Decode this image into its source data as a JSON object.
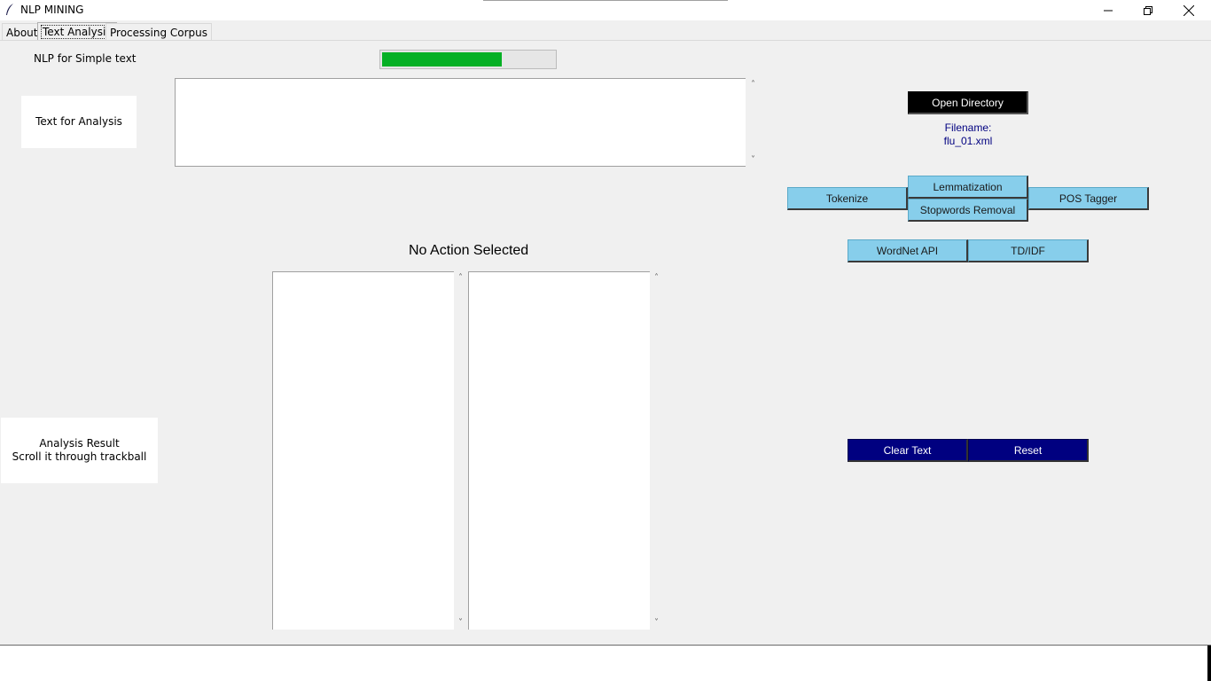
{
  "window": {
    "title": "NLP MINING",
    "controls": {
      "minimize": "minimize-icon",
      "maximize": "restore-icon",
      "close": "close-icon"
    }
  },
  "tabs": [
    {
      "label": "About"
    },
    {
      "label": "Text Analysis",
      "active": true
    },
    {
      "label": "Processing Corpus"
    }
  ],
  "header": {
    "label": "NLP for Simple text"
  },
  "progress": {
    "value": 0.69,
    "color": "#06b025"
  },
  "labels": {
    "text_for_analysis": "Text for Analysis",
    "analysis_result_line1": "Analysis Result",
    "analysis_result_line2": "Scroll it through trackball"
  },
  "input": {
    "value": ""
  },
  "status": {
    "text": "No Action Selected"
  },
  "results": {
    "left": "",
    "right": ""
  },
  "file": {
    "open_button": "Open Directory",
    "filename_label": "Filename:",
    "filename_value": "flu_01.xml"
  },
  "actions": {
    "tokenize": "Tokenize",
    "lemmatization": "Lemmatization",
    "stopwords": "Stopwords Removal",
    "pos_tagger": "POS Tagger",
    "wordnet": "WordNet API",
    "tdidf": "TD/IDF",
    "clear_text": "Clear Text",
    "reset": "Reset"
  },
  "colors": {
    "action_button": "#87ceeb",
    "open_button": "#000000",
    "control_button": "#000080",
    "filename_text": "#000080"
  }
}
